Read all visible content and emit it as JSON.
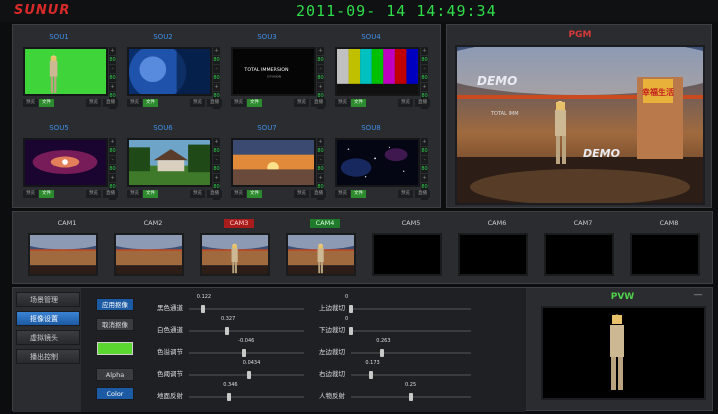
{
  "app": {
    "brand": "SUNUR",
    "clock": "2011-09- 14   14:49:34"
  },
  "sources": [
    {
      "label": "SOU1",
      "content": "green-screen-presenter"
    },
    {
      "label": "SOU2",
      "content": "blue-abstract"
    },
    {
      "label": "SOU3",
      "content": "title-text"
    },
    {
      "label": "SOU4",
      "content": "color-bars"
    },
    {
      "label": "SOU5",
      "content": "galaxy"
    },
    {
      "label": "SOU6",
      "content": "house-garden"
    },
    {
      "label": "SOU7",
      "content": "sunset"
    },
    {
      "label": "SOU8",
      "content": "starfield"
    }
  ],
  "source_text": {
    "sou3_line1": "TOTAL IMMERSION",
    "sou3_line2": "D'FUSION"
  },
  "source_side_buttons": [
    "+",
    "80",
    "-",
    "80",
    "+",
    "80",
    "-"
  ],
  "source_buttons": {
    "left_a": "预览",
    "left_b": "文件",
    "right_a": "预览",
    "right_b": "直播"
  },
  "pgm": {
    "title": "PGM",
    "demo_top": "DEMO",
    "demo_bottom": "DEMO",
    "side_text": "TOTAL IMM",
    "logo_text": "幸福生活"
  },
  "cams": [
    {
      "label": "CAM1",
      "state": "normal",
      "filled": true
    },
    {
      "label": "CAM2",
      "state": "normal",
      "filled": true
    },
    {
      "label": "CAM3",
      "state": "red",
      "filled": true
    },
    {
      "label": "CAM4",
      "state": "green",
      "filled": true
    },
    {
      "label": "CAM5",
      "state": "normal",
      "filled": false
    },
    {
      "label": "CAM6",
      "state": "normal",
      "filled": false
    },
    {
      "label": "CAM7",
      "state": "normal",
      "filled": false
    },
    {
      "label": "CAM8",
      "state": "normal",
      "filled": false
    }
  ],
  "nav": {
    "items": [
      "场景管理",
      "抠像设置",
      "虚拟镜头",
      "播出控制"
    ],
    "active": 1
  },
  "settings": {
    "apply_key": "应用抠像",
    "cancel_key": "取消抠像",
    "key_color": "#5bd82f",
    "alpha": "Alpha",
    "color": "Color",
    "sliders_left": [
      {
        "label": "黑色通道",
        "value": "0.122",
        "fraction": 0.12
      },
      {
        "label": "白色通道",
        "value": "0.327",
        "fraction": 0.33
      },
      {
        "label": "色溢调节",
        "value": "-0.046",
        "fraction": 0.48
      },
      {
        "label": "色阈调节",
        "value": "0.0434",
        "fraction": 0.52
      },
      {
        "label": "地面反射",
        "value": "0.346",
        "fraction": 0.35
      }
    ],
    "sliders_right": [
      {
        "label": "上边裁切",
        "value": "0",
        "fraction": 0.0
      },
      {
        "label": "下边裁切",
        "value": "0",
        "fraction": 0.0
      },
      {
        "label": "左边裁切",
        "value": "0.263",
        "fraction": 0.26
      },
      {
        "label": "右边裁切",
        "value": "0.173",
        "fraction": 0.17
      },
      {
        "label": "人物反射",
        "value": "0.25",
        "fraction": 0.5
      }
    ]
  },
  "pvw": {
    "title": "PVW",
    "minimize": "—"
  }
}
